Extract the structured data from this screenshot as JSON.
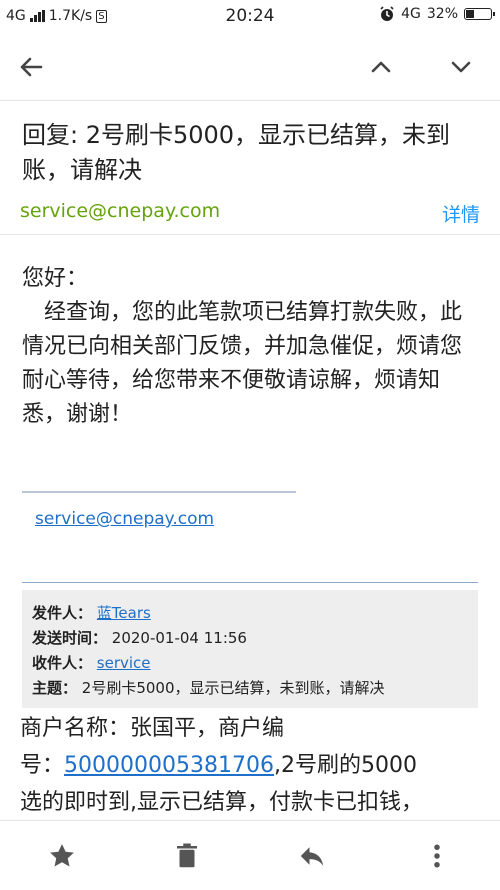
{
  "status_bar": {
    "network": "4G",
    "speed": "1.7K/s",
    "time": "20:24",
    "network_right": "4G",
    "battery": "32%",
    "battery_level": 0.32
  },
  "toolbar": {
    "back_icon": "arrow-left-icon",
    "prev_icon": "chevron-up-icon",
    "next_icon": "chevron-down-icon"
  },
  "message": {
    "subject": "回复: 2号刷卡5000，显示已结算，未到账，请解决",
    "from": "service@cnepay.com",
    "details_label": "详情",
    "greeting": "您好：",
    "body": "　经查询，您的此笔款项已结算打款失败，此情况已向相关部门反馈，并加急催促，烦请您耐心等待，给您带来不便敬请谅解，烦请知悉，谢谢！",
    "signature_link": "service@cnepay.com"
  },
  "quoted": {
    "from_label": "发件人：",
    "from_value": "蓝Tears",
    "sent_label": "发送时间：",
    "sent_value": "2020-01-04 11:56",
    "to_label": "收件人：",
    "to_value": "service",
    "subject_label": "主题：",
    "subject_value": "2号刷卡5000，显示已结算，未到账，请解决"
  },
  "original": {
    "line1": "商户名称：张国平，商户编",
    "line2_prefix": "号：",
    "merchant_no": "500000005381706",
    "line2_suffix": ",2号刷的5000",
    "line3": "选的即时到,显示已结算，付款卡已扣钱，"
  },
  "bottom_bar": {
    "star_icon": "star-icon",
    "delete_icon": "trash-icon",
    "reply_icon": "reply-icon",
    "more_icon": "more-vertical-icon"
  }
}
